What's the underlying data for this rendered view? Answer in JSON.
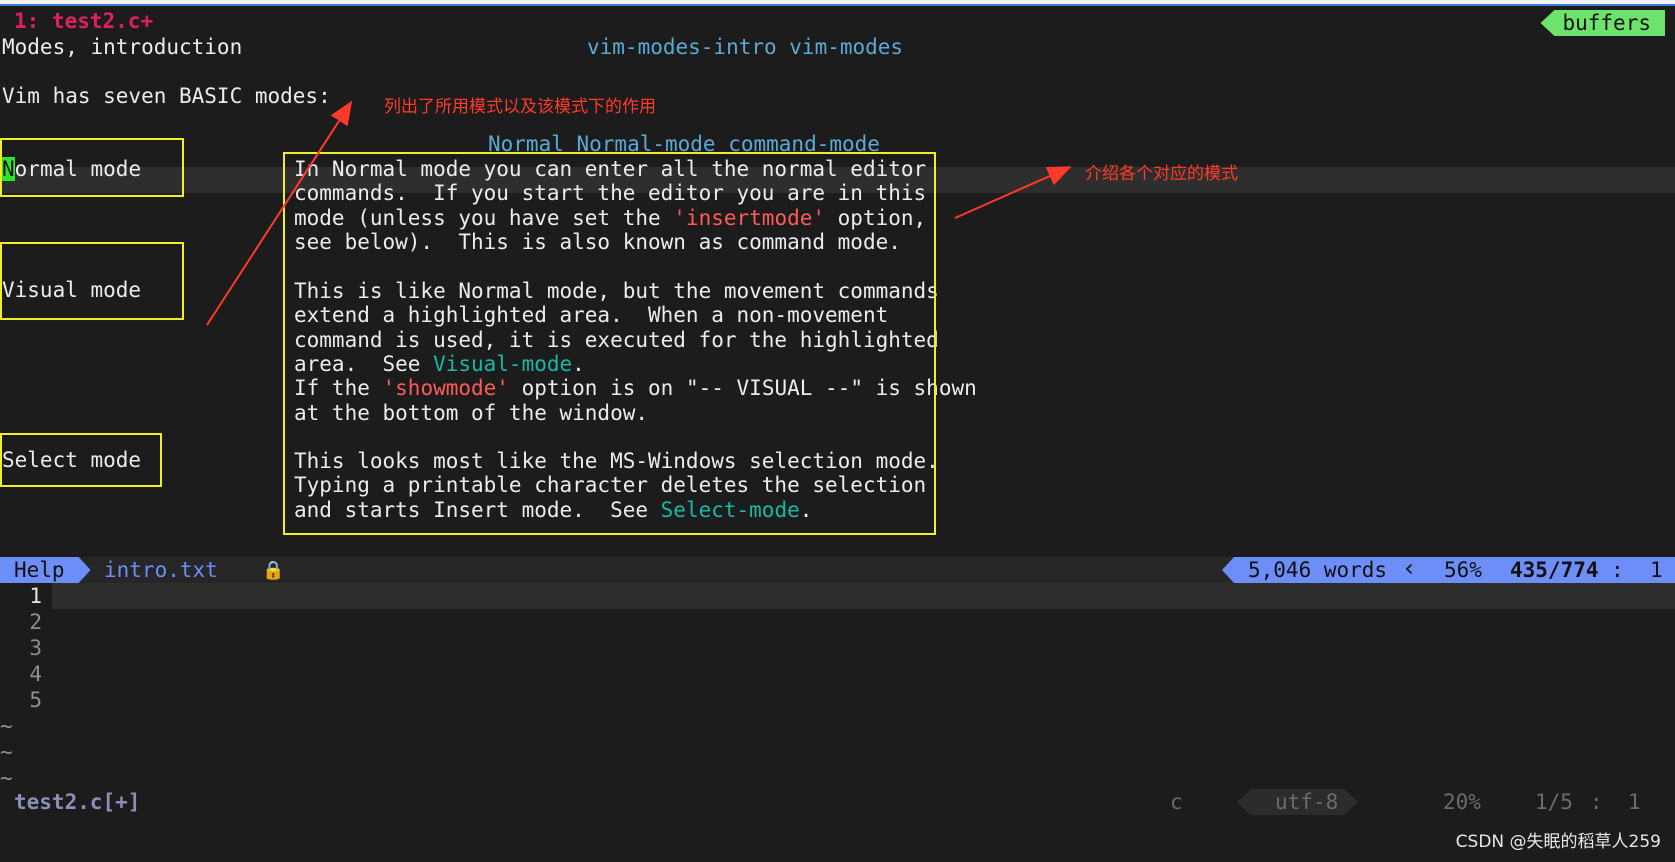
{
  "tabline": {
    "tab_number": "1:",
    "tab_name": "test2.c+",
    "buffers_label": "buffers"
  },
  "help": {
    "heading": "Modes, introduction",
    "heading_tags": "vim-modes-intro vim-modes",
    "intro_line": "Vim has seven BASIC modes:",
    "normal_tags": "Normal Normal-mode command-mode",
    "modes": [
      {
        "name": "Normal mode"
      },
      {
        "name": "Visual mode"
      },
      {
        "name": "Select mode"
      }
    ],
    "normal_desc": [
      "In Normal mode you can enter all the normal editor",
      "commands.  If you start the editor you are in this",
      {
        "pre": "mode (unless you have set the ",
        "hl": "'insertmode'",
        "post": " option,"
      },
      "see below).  This is also known as command mode."
    ],
    "visual_desc": [
      "This is like Normal mode, but the movement commands",
      "extend a highlighted area.  When a non-movement",
      "command is used, it is executed for the highlighted",
      {
        "pre": "area.  See ",
        "link": "Visual-mode",
        "post": "."
      },
      {
        "pre": "If the ",
        "hl": "'showmode'",
        "post": " option is on \"-- VISUAL --\" is shown"
      },
      "at the bottom of the window."
    ],
    "select_desc": [
      "This looks most like the MS-Windows selection mode.",
      "Typing a printable character deletes the selection",
      {
        "pre": "and starts Insert mode.  See ",
        "link": "Select-mode",
        "post": "."
      }
    ]
  },
  "annotations": {
    "left": "列出了所用模式以及该模式下的作用",
    "right": "介绍各个对应的模式"
  },
  "statusline": {
    "mode": "Help",
    "file": "intro.txt",
    "lock_icon": "🔒",
    "words": "5,046 words",
    "percent": "56%",
    "position": "435/774",
    "sep": ":",
    "column": "1"
  },
  "editor": {
    "line_numbers": [
      "1",
      "2",
      "3",
      "4",
      "5"
    ],
    "tildes": [
      "~",
      "~",
      "~"
    ]
  },
  "statusline2": {
    "file": "test2.c[+]",
    "filetype": "c",
    "encoding": "utf-8",
    "percent": "20%",
    "position": "1/5",
    "sep": ":",
    "column": "1"
  },
  "watermark": "CSDN @失眠的稻草人259",
  "colors": {
    "background": "#1c1c1c",
    "accent_green": "#6de36d",
    "accent_blue": "#6e8ef7",
    "option_red": "#ff5a5a",
    "link_teal": "#17b8a8",
    "tag_blue": "#5aa9d6",
    "annotation_red": "#ff3a2a",
    "box_yellow": "#f0f02a"
  }
}
